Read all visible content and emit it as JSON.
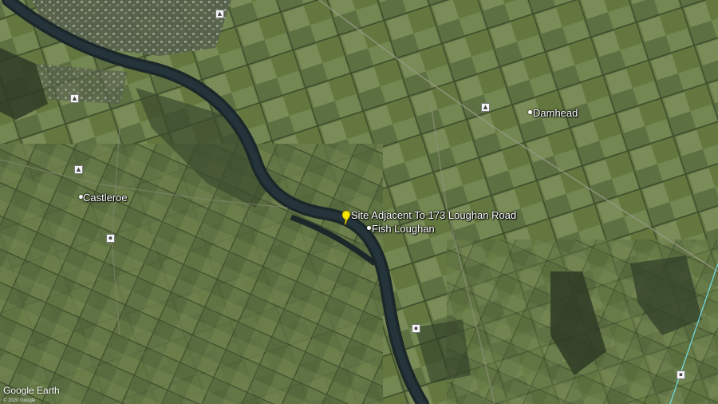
{
  "map": {
    "places": [
      {
        "id": "damhead",
        "name": "Damhead"
      },
      {
        "id": "castleroe",
        "name": "Castleroe"
      },
      {
        "id": "fish-loughan",
        "name": "Fish Loughan"
      }
    ],
    "pin": {
      "label": "Site Adjacent To 173 Loughan Road",
      "color": "#f5e400",
      "icon": "pushpin-icon"
    },
    "branding": {
      "watermark": "Google Earth",
      "copyright": "© 2020 Google"
    },
    "colors": {
      "fields_light": "#6f8350",
      "fields_dark": "#4b5c36",
      "river": "#1c2a2c",
      "woodland": "#34422a"
    }
  }
}
